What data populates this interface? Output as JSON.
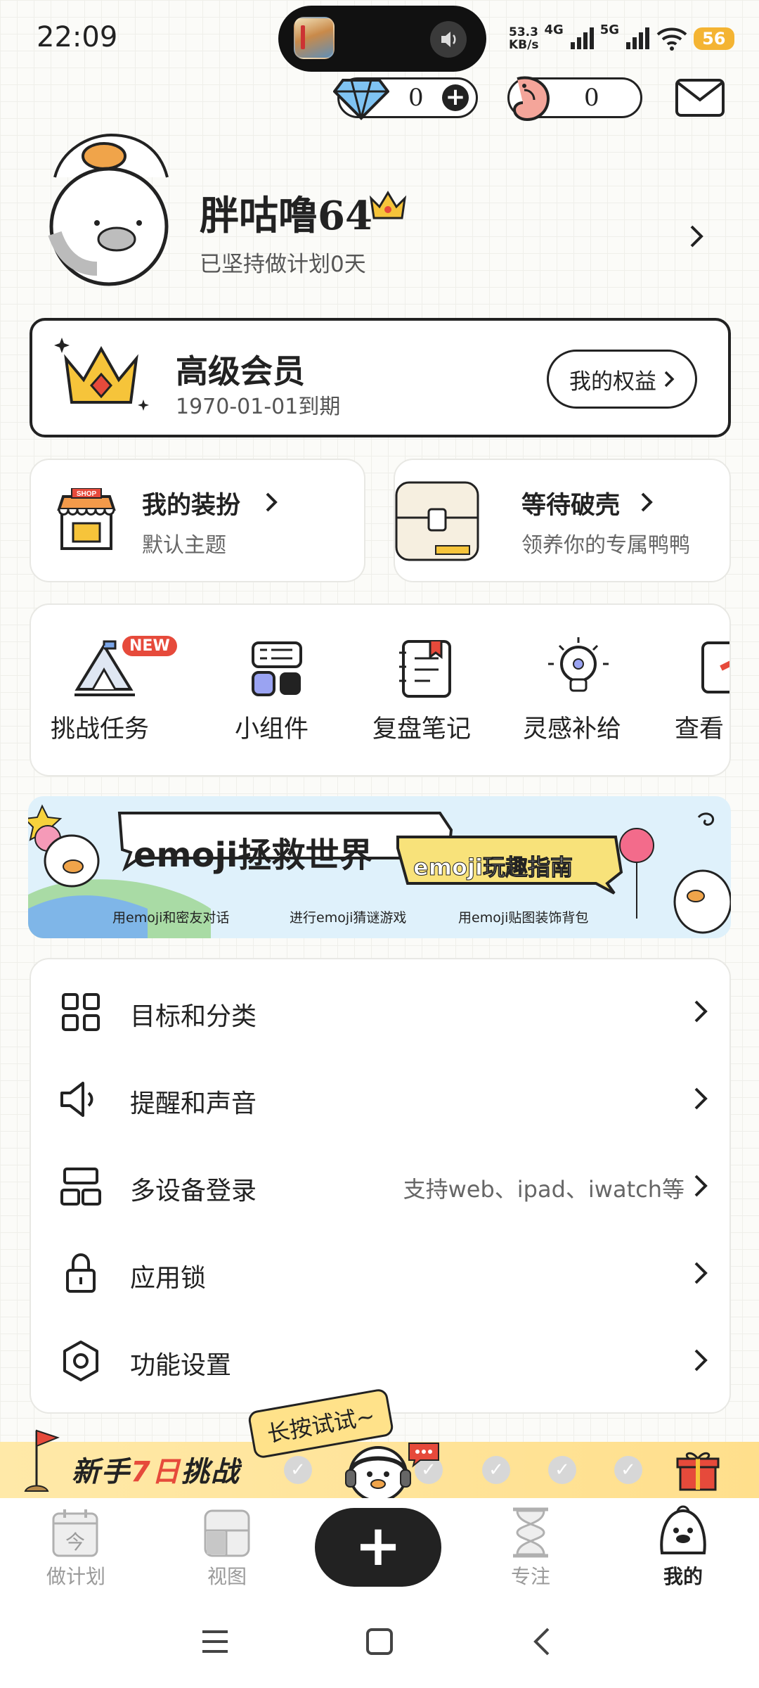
{
  "status_bar": {
    "time": "22:09",
    "net_speed_top": "53.3",
    "net_speed_bottom": "KB/s",
    "net1": "4G",
    "net2": "5G",
    "battery": "56"
  },
  "currency": {
    "diamonds": "0",
    "second": "0"
  },
  "profile": {
    "username": "胖咕噜64",
    "streak": "已坚持做计划0天"
  },
  "vip": {
    "title": "高级会员",
    "expiry": "1970-01-01到期",
    "rights_button": "我的权益"
  },
  "shop": {
    "title": "我的装扮",
    "subtitle": "默认主题",
    "badge": "SHOP"
  },
  "hatch": {
    "title": "等待破壳",
    "subtitle": "领养你的专属鸭鸭"
  },
  "tools": [
    {
      "label": "挑战任务",
      "badge": "NEW"
    },
    {
      "label": "小组件"
    },
    {
      "label": "复盘笔记"
    },
    {
      "label": "灵感补给"
    },
    {
      "label": "查看"
    }
  ],
  "banner": {
    "title": "emoji拯救世界",
    "tag": "emoji玩趣指南",
    "tip1": "用emoji和密友对话",
    "tip2": "进行emoji猜谜游戏",
    "tip3": "用emoji贴图装饰背包"
  },
  "menu": [
    {
      "label": "目标和分类",
      "extra": ""
    },
    {
      "label": "提醒和声音",
      "extra": ""
    },
    {
      "label": "多设备登录",
      "extra": "支持web、ipad、iwatch等"
    },
    {
      "label": "应用锁",
      "extra": ""
    },
    {
      "label": "功能设置",
      "extra": ""
    }
  ],
  "challenge": {
    "title_a": "新手",
    "title_b": "7日",
    "title_c": "挑战",
    "tooltip": "长按试试~"
  },
  "tabs": [
    {
      "label": "做计划",
      "icon_text": "今"
    },
    {
      "label": "视图"
    },
    {
      "label": "专注"
    },
    {
      "label": "我的"
    }
  ],
  "accent": {
    "challenge_red": "#e64a3b",
    "gold": "#f4b433",
    "dark": "#222222"
  }
}
